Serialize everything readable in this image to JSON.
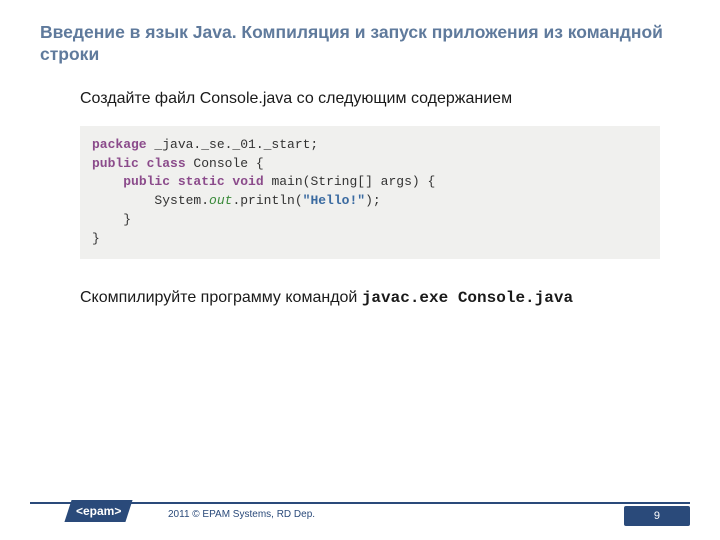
{
  "title": "Введение в язык Java. Компиляция и запуск приложения из командной строки",
  "intro": "Создайте файл Console.java со следующим содержанием",
  "code": {
    "l1_kw": "package",
    "l1_rest": " _java._se._01._start;",
    "l2_kw": "public class",
    "l2_rest": " Console {",
    "l3_kw": "public static void",
    "l3_rest": " main(String[] args) {",
    "l4_pre": "        System.",
    "l4_out": "out",
    "l4_mid": ".println(",
    "l4_str": "\"Hello!\"",
    "l4_post": ");",
    "l5": "    }",
    "l6": "}"
  },
  "compile": {
    "text": "Скомпилируйте программу командой ",
    "cmd": "javac.exe Console.java"
  },
  "footer": {
    "logo": "<epam>",
    "copyright": "2011 © EPAM Systems, RD Dep.",
    "page": "9"
  }
}
